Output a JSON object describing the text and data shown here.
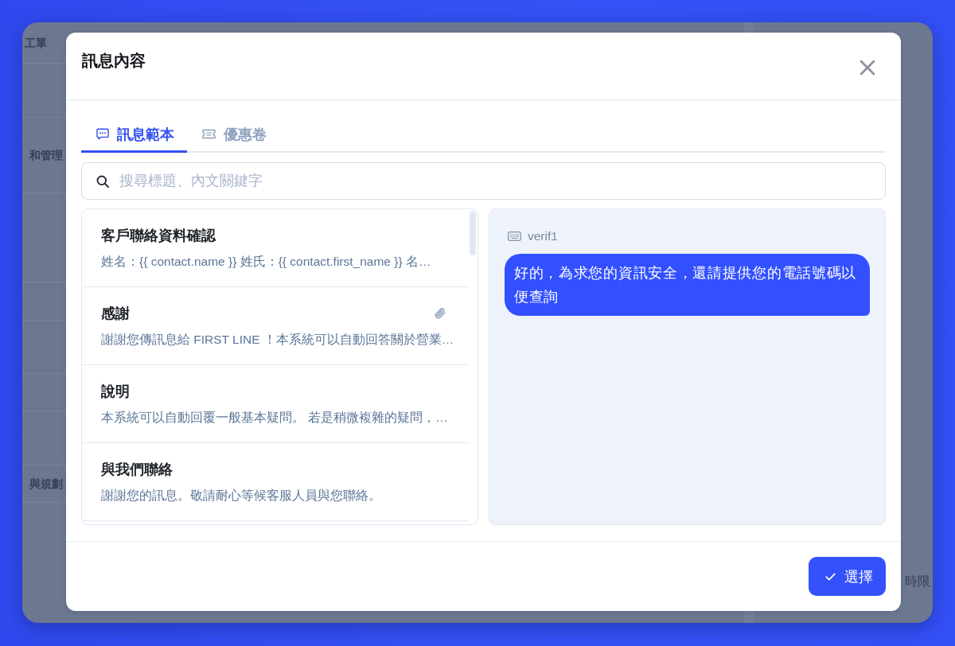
{
  "backdrop": {
    "labels": [
      "工單",
      "和管理",
      "與規劃"
    ],
    "side_label": "時限"
  },
  "dialog": {
    "title": "訊息內容"
  },
  "tabs": [
    {
      "label": "訊息範本",
      "kind": "template",
      "selected": true
    },
    {
      "label": "優惠卷",
      "kind": "coupon",
      "selected": false
    }
  ],
  "search": {
    "placeholder": "搜尋標題、內文關鍵字"
  },
  "templates": [
    {
      "title": "客戶聯絡資料確認",
      "preview": "姓名：{{ contact.name }} 姓氏：{{ contact.first_name }} 名…",
      "attachment": false
    },
    {
      "title": "感謝",
      "preview": "謝謝您傳訊息給 FIRST LINE ！本系統可以自動回答關於營業…",
      "attachment": true
    },
    {
      "title": "說明",
      "preview": "本系統可以自動回覆一般基本疑問。 若是稍微複雜的疑問，…",
      "attachment": false
    },
    {
      "title": "與我們聯絡",
      "preview": "謝謝您的訊息。敬請耐心等候客服人員與您聯絡。",
      "attachment": false
    }
  ],
  "preview": {
    "name": "verif1",
    "message": "好的，為求您的資訊安全，還請提供您的電話號碼以便查詢"
  },
  "footer": {
    "select_button": "選擇"
  }
}
